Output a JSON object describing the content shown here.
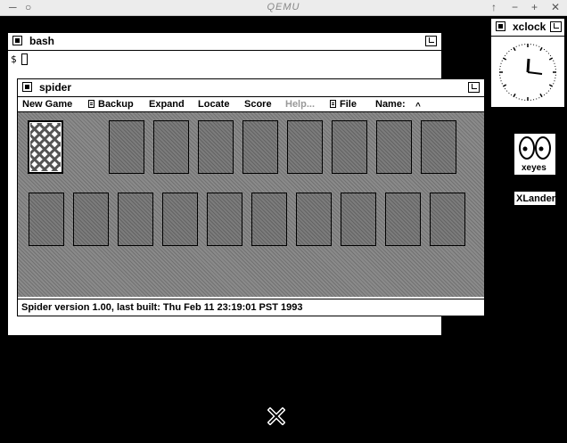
{
  "qemu": {
    "title": "QEMU",
    "controls": [
      "↑",
      "−",
      "+",
      "✕"
    ]
  },
  "bash": {
    "title": "bash",
    "prompt": "$"
  },
  "spider": {
    "title": "spider",
    "menu": {
      "new_game": "New Game",
      "backup": "Backup",
      "expand": "Expand",
      "locate": "Locate",
      "score": "Score",
      "help": "Help...",
      "file": "File",
      "name": "Name:"
    },
    "status": "Spider version 1.00, last built: Thu Feb 11 23:19:01 PST 1993"
  },
  "xclock": {
    "title": "xclock"
  },
  "desktop_icons": {
    "xeyes": "xeyes",
    "xlander": "XLander"
  },
  "colors": {
    "table": "#8a8a8a",
    "background": "#000000",
    "qemu_bar": "#ececec"
  }
}
